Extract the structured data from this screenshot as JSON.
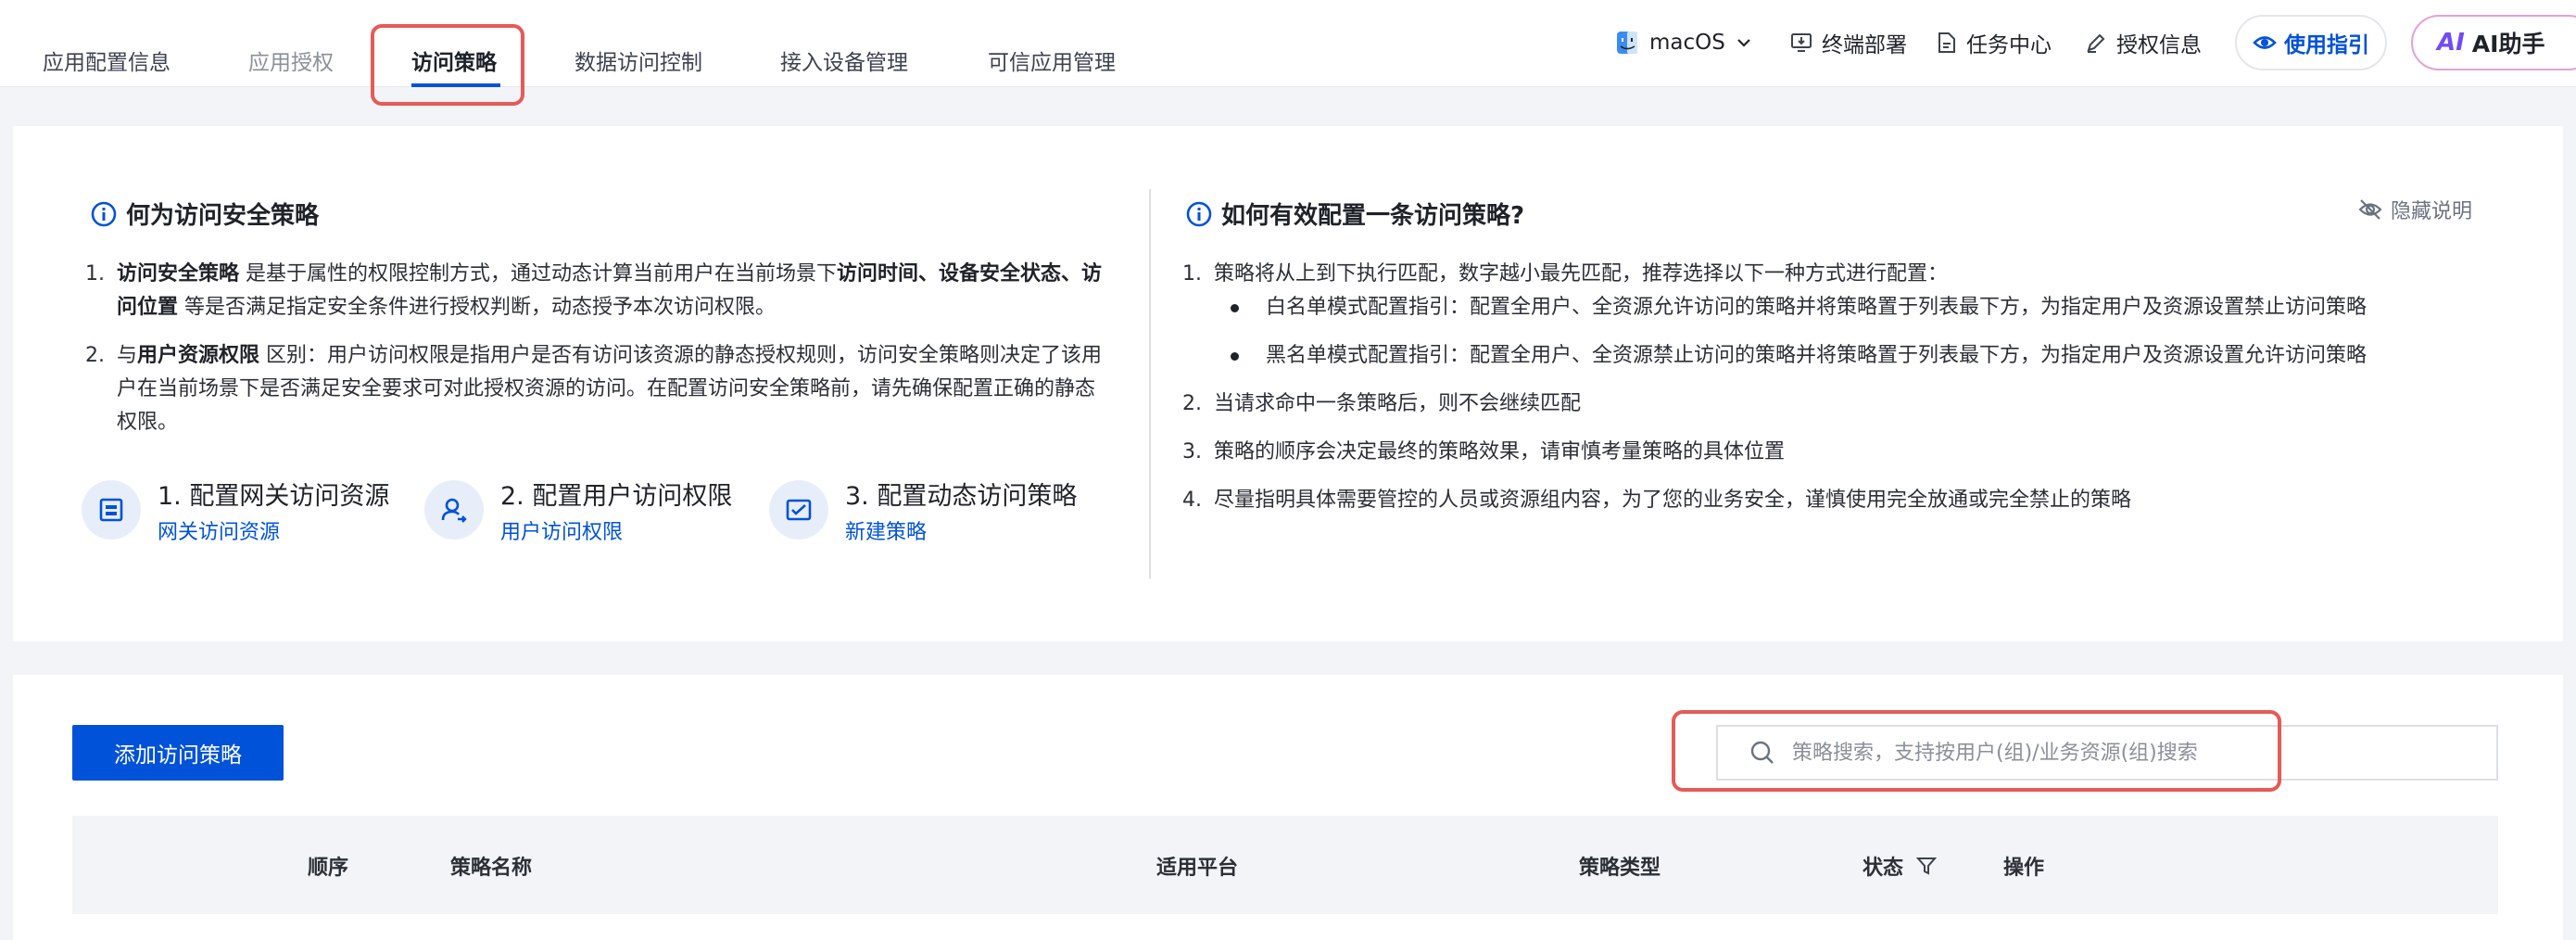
{
  "tabs": [
    {
      "label": "应用配置信息",
      "state": "normal"
    },
    {
      "label": "应用授权",
      "state": "disabled"
    },
    {
      "label": "访问策略",
      "state": "active"
    },
    {
      "label": "数据访问控制",
      "state": "normal"
    },
    {
      "label": "接入设备管理",
      "state": "normal"
    },
    {
      "label": "可信应用管理",
      "state": "normal"
    }
  ],
  "nav_right": {
    "platform": "macOS",
    "terminal_deploy": "终端部署",
    "task_center": "任务中心",
    "license_info": "授权信息",
    "guide": "使用指引",
    "ai_logo": "AI",
    "ai_assistant": "AI助手"
  },
  "intro": {
    "title": "何为访问安全策略",
    "p1": {
      "num": "1.",
      "b1": "访问安全策略",
      "t1": " 是基于属性的权限控制方式，通过动态计算当前用户在当前场景下",
      "b2": "访问时间、设备安全状态、访问位置",
      "t2": " 等是否满足指定安全条件进行授权判断，动态授予本次访问权限。"
    },
    "p2": {
      "num": "2.",
      "t1": "与",
      "b1": "用户资源权限",
      "t2": " 区别：用户访问权限是指用户是否有访问该资源的静态授权规则，访问安全策略则决定了该用户在当前场景下是否满足安全要求可对此授权资源的访问。在配置访问安全策略前，请先确保配置正确的静态权限。"
    },
    "steps": [
      {
        "title": "1. 配置网关访问资源",
        "link": "网关访问资源",
        "icon": "gateway-resource-icon"
      },
      {
        "title": "2. 配置用户访问权限",
        "link": "用户访问权限",
        "icon": "user-permission-icon"
      },
      {
        "title": "3. 配置动态访问策略",
        "link": "新建策略",
        "icon": "dynamic-policy-icon"
      }
    ]
  },
  "howto": {
    "title": "如何有效配置一条访问策略?",
    "hide_label": "隐藏说明",
    "items": [
      {
        "num": "1.",
        "text": "策略将从上到下执行匹配，数字越小最先匹配，推荐选择以下一种方式进行配置："
      },
      {
        "num": "2.",
        "text": "当请求命中一条策略后，则不会继续匹配"
      },
      {
        "num": "3.",
        "text": "策略的顺序会决定最终的策略效果，请审慎考量策略的具体位置"
      },
      {
        "num": "4.",
        "text": "尽量指明具体需要管控的人员或资源组内容，为了您的业务安全，谨慎使用完全放通或完全禁止的策略"
      }
    ],
    "bullets": [
      "白名单模式配置指引：配置全用户、全资源允许访问的策略并将策略置于列表最下方，为指定用户及资源设置禁止访问策略",
      "黑名单模式配置指引：配置全用户、全资源禁止访问的策略并将策略置于列表最下方，为指定用户及资源设置允许访问策略"
    ]
  },
  "list": {
    "add_button": "添加访问策略",
    "search_value": "",
    "search_placeholder": "策略搜索，支持按用户(组)/业务资源(组)搜索",
    "columns": [
      "顺序",
      "策略名称",
      "适用平台",
      "策略类型",
      "状态",
      "操作"
    ]
  },
  "colors": {
    "primary": "#0052d9",
    "highlight": "#e65a57",
    "page_bg": "#f3f4f7"
  }
}
